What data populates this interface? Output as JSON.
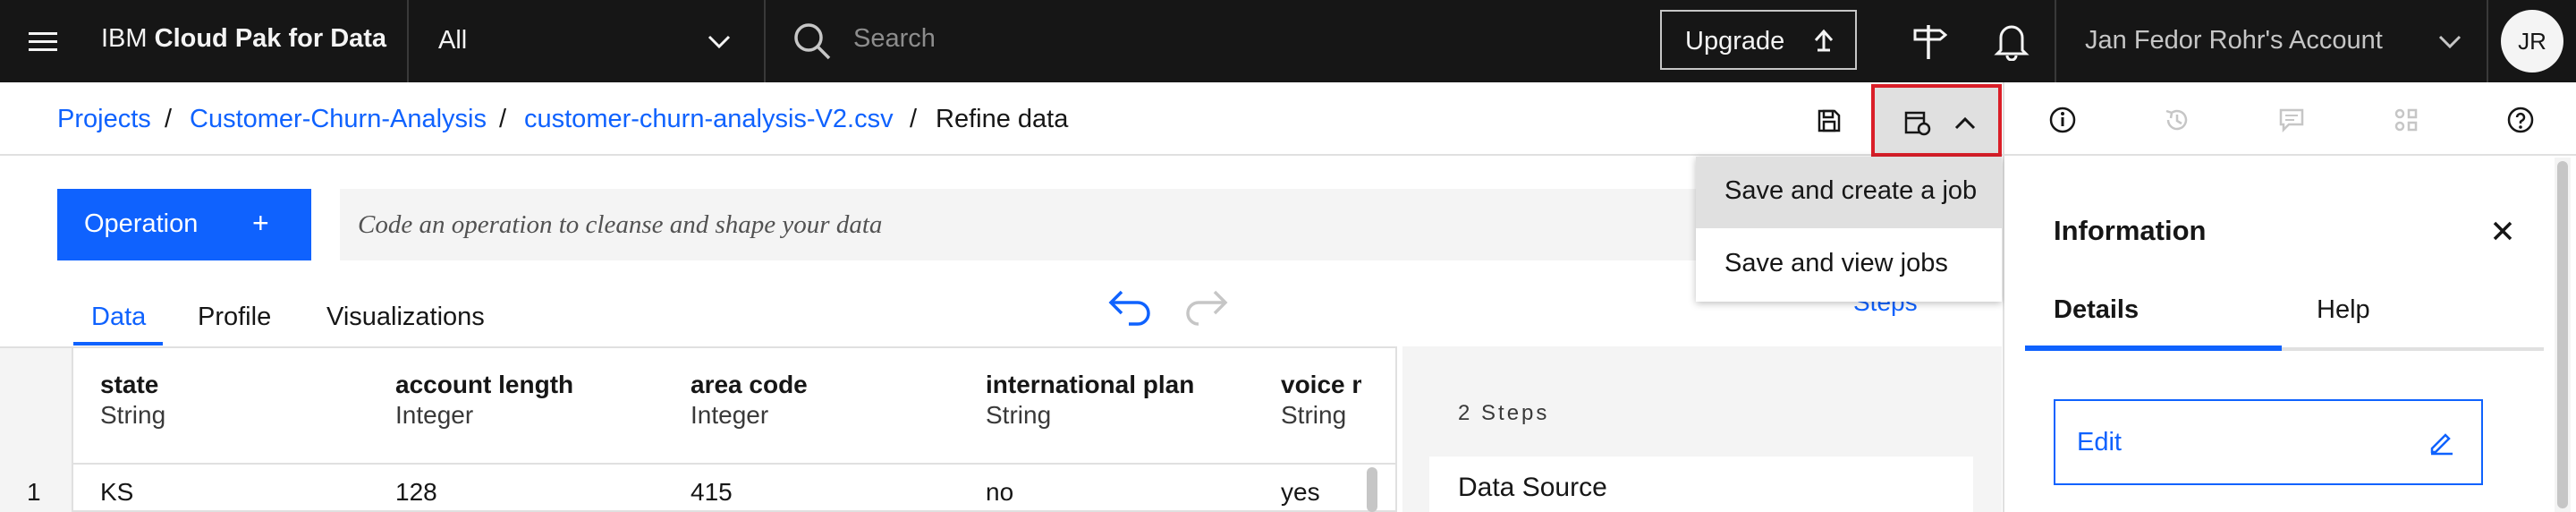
{
  "header": {
    "menu_icon": "hamburger-menu-icon",
    "brand_prefix": "IBM",
    "brand_name": "Cloud Pak for Data",
    "scope_selector": "All",
    "search_placeholder": "Search",
    "upgrade_label": "Upgrade",
    "account_label": "Jan Fedor Rohr's Account",
    "avatar_initials": "JR"
  },
  "breadcrumb": {
    "items": [
      "Projects",
      "Customer-Churn-Analysis",
      "customer-churn-analysis-V2.csv"
    ],
    "current": "Refine data",
    "separator": "/"
  },
  "toolbar": {
    "dropdown": {
      "items": [
        "Save and create a job",
        "Save and view jobs"
      ]
    }
  },
  "operation": {
    "button_label": "Operation",
    "plus": "+",
    "code_placeholder": "Code an operation to cleanse and shape your data"
  },
  "tabs": [
    "Data",
    "Profile",
    "Visualizations"
  ],
  "table": {
    "columns": [
      {
        "name": "state",
        "type": "String"
      },
      {
        "name": "account length",
        "type": "Integer"
      },
      {
        "name": "area code",
        "type": "Integer"
      },
      {
        "name": "international plan",
        "type": "String"
      },
      {
        "name": "voice m",
        "type": "String"
      }
    ],
    "rows": [
      {
        "index": "1",
        "cells": [
          "KS",
          "128",
          "415",
          "no",
          "yes"
        ]
      }
    ]
  },
  "steps": {
    "link_label": "Steps",
    "count_label": "2 Steps",
    "first_step": "Data Source"
  },
  "info_panel": {
    "title": "Information",
    "tabs": [
      "Details",
      "Help"
    ],
    "edit_label": "Edit"
  },
  "colors": {
    "accent": "#0f62fe",
    "topbar": "#161616",
    "highlight_border": "#da1e28"
  }
}
